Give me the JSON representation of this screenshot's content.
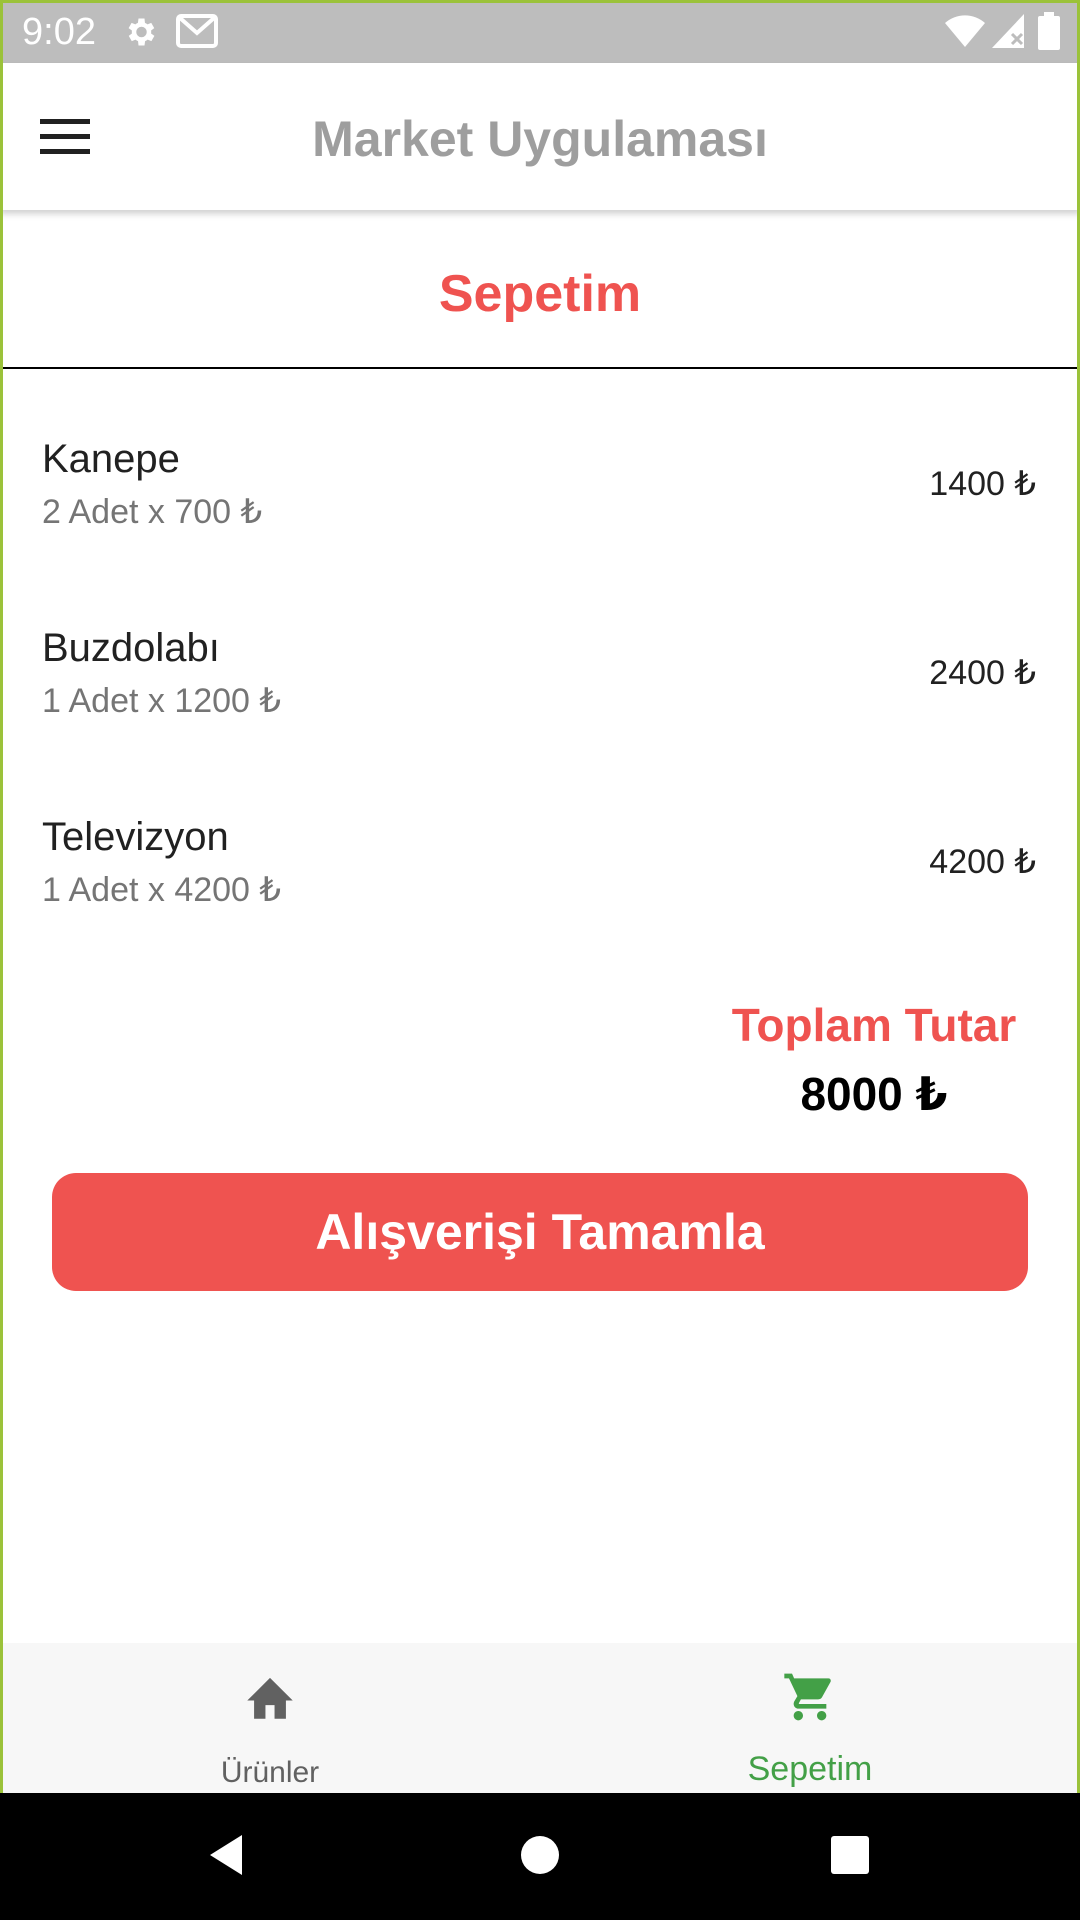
{
  "status_bar": {
    "time": "9:02",
    "left_icons": [
      "settings-icon",
      "gmail-icon"
    ],
    "right_icons": [
      "wifi-icon",
      "cellular-signal-icon",
      "battery-icon"
    ]
  },
  "app_bar": {
    "title": "Market Uygulaması",
    "menu_icon": "hamburger-menu-icon"
  },
  "page": {
    "heading": "Sepetim",
    "heading_color": "#ef5350"
  },
  "cart": {
    "items": [
      {
        "name": "Kanepe",
        "detail": "2 Adet x 700 ₺",
        "total": "1400 ₺"
      },
      {
        "name": "Buzdolabı",
        "detail": "1 Adet x 1200 ₺",
        "total": "2400 ₺"
      },
      {
        "name": "Televizyon",
        "detail": "1 Adet x 4200 ₺",
        "total": "4200 ₺"
      }
    ],
    "total_label": "Toplam Tutar",
    "total_value": "8000 ₺",
    "checkout_label": "Alışverişi Tamamla"
  },
  "bottom_nav": {
    "items": [
      {
        "label": "Ürünler",
        "icon": "home-icon",
        "active": false
      },
      {
        "label": "Sepetim",
        "icon": "shopping-cart-icon",
        "active": true
      }
    ],
    "active_color": "#43a047",
    "inactive_color": "#616161"
  },
  "system_nav": {
    "buttons": [
      "back-icon",
      "home-circle-icon",
      "recents-square-icon"
    ]
  }
}
